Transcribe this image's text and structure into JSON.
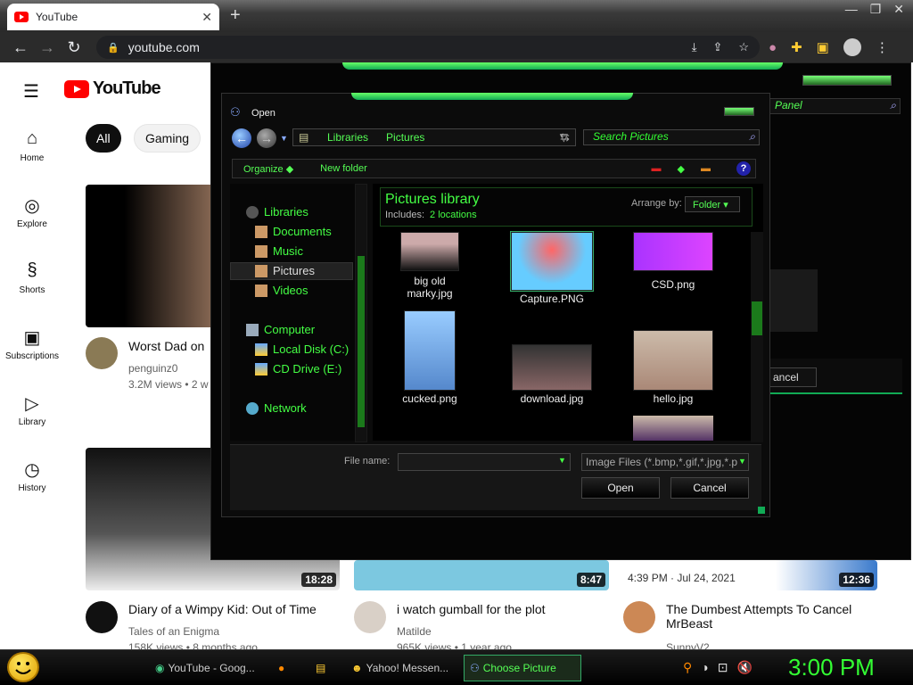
{
  "browser": {
    "tab_title": "YouTube",
    "tab_close": "✕",
    "new_tab": "+",
    "url": "youtube.com",
    "window_controls": [
      "—",
      "❐",
      "✕"
    ]
  },
  "youtube": {
    "logo_text": "YouTube",
    "chips": [
      "All",
      "Gaming"
    ],
    "sidebar": [
      {
        "label": "Home",
        "icon": "⌂"
      },
      {
        "label": "Explore",
        "icon": "◎"
      },
      {
        "label": "Shorts",
        "icon": "§"
      },
      {
        "label": "Subscriptions",
        "icon": "▣"
      },
      {
        "label": "Library",
        "icon": "▷"
      },
      {
        "label": "History",
        "icon": "◷"
      }
    ],
    "videos": [
      {
        "title": "Worst Dad on",
        "channel": "penguinz0",
        "meta": "3.2M views • 2 w"
      },
      {
        "title": "Diary of a Wimpy Kid: Out of Time",
        "channel": "Tales of an Enigma",
        "meta": "158K views • 8 months ago",
        "duration": "18:28"
      },
      {
        "title": "i watch gumball for the plot",
        "channel": "Matilde",
        "meta": "965K views • 1 year ago",
        "duration": "8:47"
      },
      {
        "title": "The Dumbest Attempts To Cancel MrBeast",
        "channel": "SunnyV2",
        "duration": "12:36",
        "overlay": "4:39 PM · Jul 24, 2021"
      }
    ]
  },
  "background_window": {
    "search_placeholder": "Panel",
    "cancel_label": "ancel"
  },
  "dialog": {
    "title": "Open",
    "address": [
      "Libraries",
      "Pictures"
    ],
    "search_placeholder": "Search Pictures",
    "toolbar": {
      "organize": "Organize",
      "new_folder": "New folder"
    },
    "nav": [
      {
        "label": "Libraries"
      },
      {
        "label": "Documents"
      },
      {
        "label": "Music"
      },
      {
        "label": "Pictures"
      },
      {
        "label": "Videos"
      },
      {
        "label": "Computer"
      },
      {
        "label": "Local Disk (C:)"
      },
      {
        "label": "CD Drive (E:)"
      },
      {
        "label": "Network"
      }
    ],
    "library_title": "Pictures library",
    "includes_label": "Includes:",
    "includes_value": "2 locations",
    "arrange_label": "Arrange by:",
    "arrange_value": "Folder",
    "files": [
      {
        "name": "big old marky.jpg"
      },
      {
        "name": "Capture.PNG"
      },
      {
        "name": "CSD.png"
      },
      {
        "name": "cucked.png"
      },
      {
        "name": "download.jpg"
      },
      {
        "name": "hello.jpg"
      }
    ],
    "file_name_label": "File name:",
    "file_name_value": "",
    "file_type": "Image Files (*.bmp,*.gif,*.jpg,*.p",
    "open_label": "Open",
    "cancel_label": "Cancel"
  },
  "taskbar": {
    "items": [
      "YouTube - Goog...",
      "Yahoo! Messen...",
      "Choose Picture"
    ],
    "clock": "3:00 PM"
  }
}
